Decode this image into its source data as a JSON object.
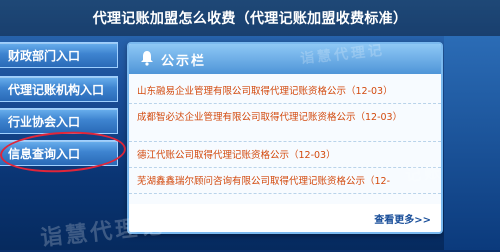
{
  "page_title": "代理记账加盟怎么收费（代理记账加盟收费标准）",
  "menu": {
    "items": [
      {
        "label": "财政部门入口"
      },
      {
        "label": "代理记账机构入口"
      },
      {
        "label": "行业协会入口"
      },
      {
        "label": "信息查询入口"
      }
    ],
    "highlight_color": "#e0263a"
  },
  "notice_panel": {
    "title": "公示栏",
    "icon": "bell-icon",
    "items": [
      {
        "text": "山东融易企业管理有限公司取得代理记账资格公示（12-03）"
      },
      {
        "text": "成都智必达企业管理有限公司取得代理记账资格公示（12-03）"
      },
      {
        "text": "德江代账公司取得代理记账资格公示（12-03）"
      },
      {
        "text": "芜湖鑫鑫瑞尔顾问咨询有限公司取得代理记账资格公示（12-"
      }
    ],
    "more_label": "查看更多>>",
    "text_color": "#d34a0e"
  },
  "watermarks": {
    "main": "诣慧代理记",
    "side": "记账",
    "top": "诣慧代理记"
  }
}
